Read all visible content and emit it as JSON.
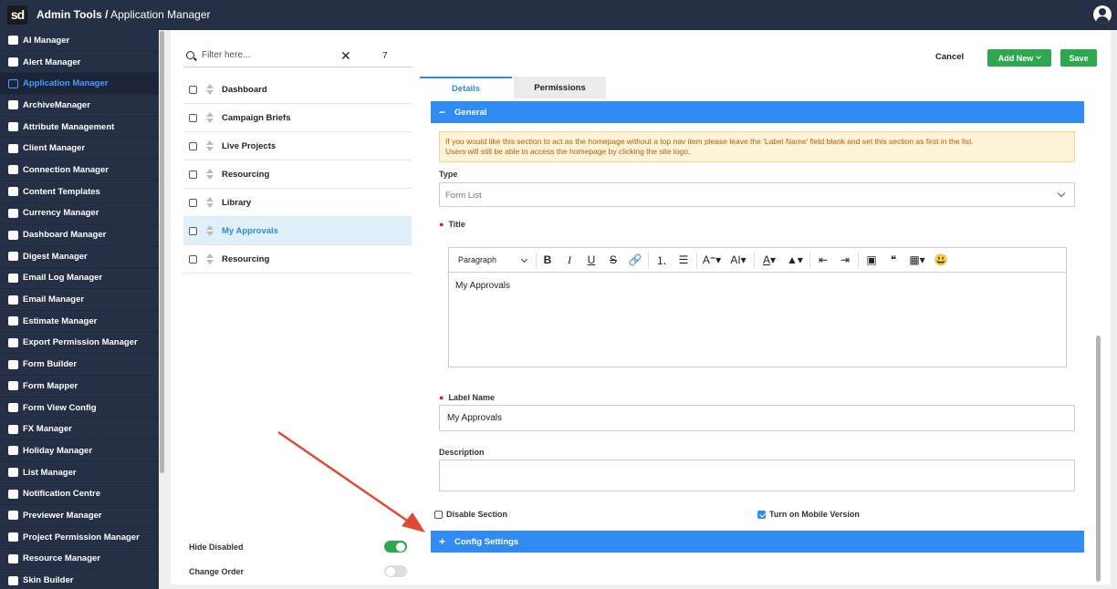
{
  "header": {
    "logo_text": "sd",
    "app_title": "Admin Tools /",
    "page_title": " Application Manager"
  },
  "sidebar": {
    "items": [
      {
        "label": "AI Manager",
        "icon": "ai-icon"
      },
      {
        "label": "Alert Manager",
        "icon": "alert-icon"
      },
      {
        "label": "Application Manager",
        "icon": "laptop-icon",
        "active": true
      },
      {
        "label": "ArchiveManager",
        "icon": "archive-icon"
      },
      {
        "label": "Attribute Management",
        "icon": "tag-icon"
      },
      {
        "label": "Client Manager",
        "icon": "edit-icon"
      },
      {
        "label": "Connection Manager",
        "icon": "lock-icon"
      },
      {
        "label": "Content Templates",
        "icon": "users-icon"
      },
      {
        "label": "Currency Manager",
        "icon": "bank-icon"
      },
      {
        "label": "Dashboard Manager",
        "icon": "dashboard-icon"
      },
      {
        "label": "Digest Manager",
        "icon": "edit-icon"
      },
      {
        "label": "Email Log Manager",
        "icon": "edit-icon"
      },
      {
        "label": "Email Manager",
        "icon": "briefcase-icon"
      },
      {
        "label": "Estimate Manager",
        "icon": "calculator-icon"
      },
      {
        "label": "Export Permission Manager",
        "icon": "lock-icon"
      },
      {
        "label": "Form Builder",
        "icon": "edit-icon"
      },
      {
        "label": "Form Mapper",
        "icon": "laptop-icon"
      },
      {
        "label": "Form View Config",
        "icon": "plus-icon"
      },
      {
        "label": "FX Manager",
        "icon": "edit-icon"
      },
      {
        "label": "Holiday Manager",
        "icon": "sun-icon"
      },
      {
        "label": "List Manager",
        "icon": "list-tree-icon"
      },
      {
        "label": "Notification Centre",
        "icon": "alert-icon"
      },
      {
        "label": "Previewer Manager",
        "icon": "edit-icon"
      },
      {
        "label": "Project Permission Manager",
        "icon": "lock-icon"
      },
      {
        "label": "Resource Manager",
        "icon": "user-gear-icon"
      },
      {
        "label": "Skin Builder",
        "icon": "brush-icon"
      }
    ]
  },
  "list_panel": {
    "filter_placeholder": "Filter here...",
    "clear_symbol": "✕",
    "count": "7",
    "items": [
      {
        "label": "Dashboard",
        "selected": false
      },
      {
        "label": "Campaign Briefs",
        "selected": false
      },
      {
        "label": "Live Projects",
        "selected": false
      },
      {
        "label": "Resourcing",
        "selected": false
      },
      {
        "label": "Library",
        "selected": false
      },
      {
        "label": "My Approvals",
        "selected": true
      },
      {
        "label": "Resourcing",
        "selected": false
      }
    ],
    "hide_disabled_label": "Hide Disabled",
    "hide_disabled_on": true,
    "change_order_label": "Change Order",
    "change_order_on": false
  },
  "actions": {
    "cancel": "Cancel",
    "add_new": "Add New",
    "save": "Save"
  },
  "tabs": {
    "details": "Details",
    "permissions": "Permissions"
  },
  "form": {
    "general_section": "General",
    "general_symbol": "−",
    "notice_line1": "If you would like this section to act as the homepage without a top nav item please leave the 'Label Name' field blank and set this section as first in the list.",
    "notice_line2": "Users will still be able to access the homepage by clicking the site logo.",
    "type_label": "Type",
    "type_value": "Form List",
    "title_label": "Title",
    "editor_paragraph": "Paragraph",
    "editor_content": "My Approvals",
    "label_name_label": "Label Name",
    "label_name_value": "My Approvals",
    "description_label": "Description",
    "description_value": "",
    "disable_section_label": "Disable Section",
    "disable_section_checked": false,
    "mobile_version_label": "Turn on Mobile Version",
    "mobile_version_checked": true,
    "config_section": "Config Settings",
    "config_symbol": "+"
  },
  "colors": {
    "nav_bg": "#252f45",
    "accent_blue": "#318bf4",
    "green": "#2ea84e",
    "annotation_arrow": "#e04a35"
  }
}
